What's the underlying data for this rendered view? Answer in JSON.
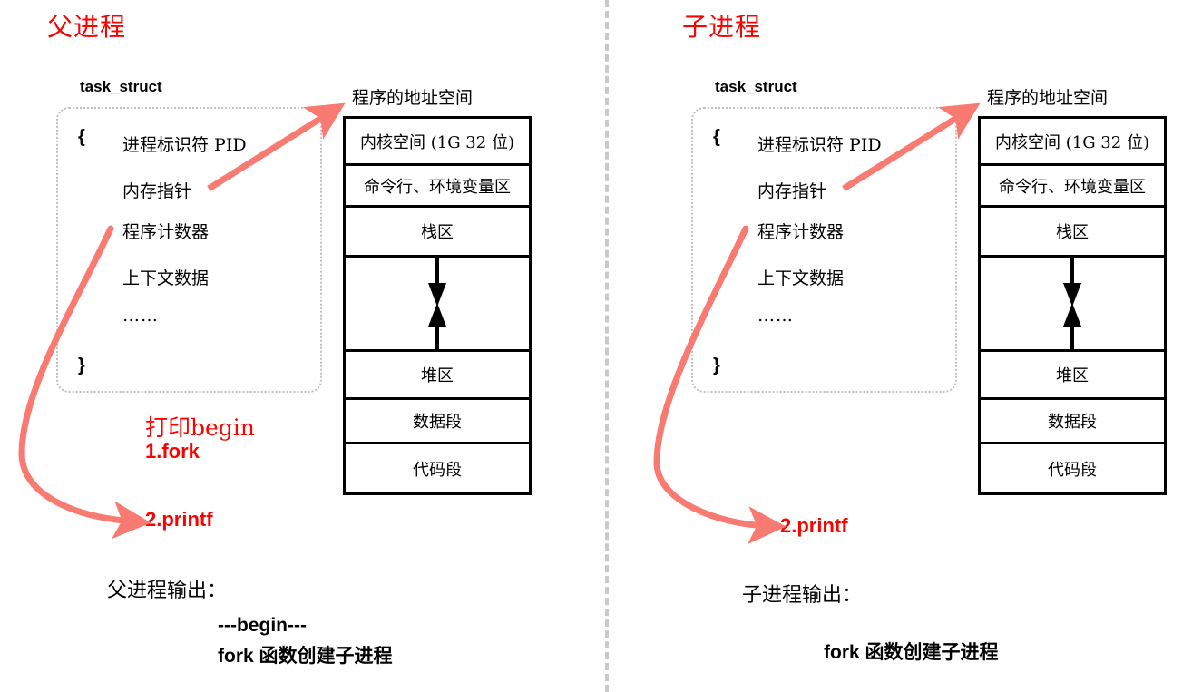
{
  "accent": {
    "title_red": "#ff0000",
    "arrow_salmon": "#f97a70",
    "divider_gray": "#c9c9c9",
    "box_black": "#000000"
  },
  "panels": [
    {
      "title": "父进程",
      "task_struct": {
        "label": "task_struct",
        "open_brace": "{",
        "close_brace": "}",
        "fields": [
          "进程标识符 PID",
          "内存指针",
          "程序计数器",
          "上下文数据"
        ],
        "ellipsis": "……"
      },
      "address_space": {
        "caption": "程序的地址空间",
        "rows": [
          "内核空间 (1G 32 位)",
          "命令行、环境变量区",
          "栈区",
          "",
          "堆区",
          "数据段",
          "代码段"
        ]
      },
      "notes": [
        "打印begin",
        "1.fork",
        "2.printf"
      ],
      "output": {
        "label": "父进程输出：",
        "lines": [
          "---begin---",
          "fork 函数创建子进程"
        ]
      }
    },
    {
      "title": "子进程",
      "task_struct": {
        "label": "task_struct",
        "open_brace": "{",
        "close_brace": "}",
        "fields": [
          "进程标识符 PID",
          "内存指针",
          "程序计数器",
          "上下文数据"
        ],
        "ellipsis": "……"
      },
      "address_space": {
        "caption": "程序的地址空间",
        "rows": [
          "内核空间 (1G 32 位)",
          "命令行、环境变量区",
          "栈区",
          "",
          "堆区",
          "数据段",
          "代码段"
        ]
      },
      "notes": [
        "2.printf"
      ],
      "output": {
        "label": "子进程输出：",
        "lines": [
          "fork 函数创建子进程"
        ]
      }
    }
  ]
}
